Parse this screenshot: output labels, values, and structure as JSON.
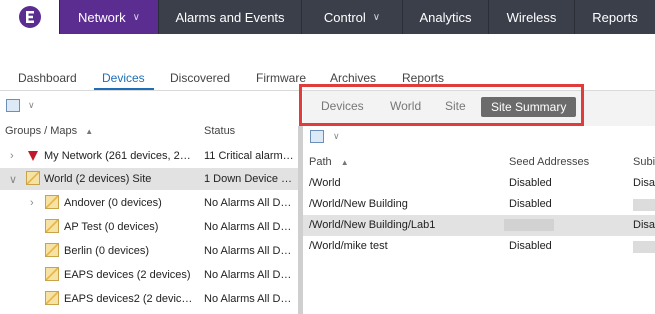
{
  "topnav": {
    "items": [
      {
        "label": "Network",
        "has_dropdown": true,
        "active": true
      },
      {
        "label": "Alarms and Events",
        "has_dropdown": false
      },
      {
        "label": "Control",
        "has_dropdown": true
      },
      {
        "label": "Analytics",
        "has_dropdown": false
      },
      {
        "label": "Wireless",
        "has_dropdown": false
      },
      {
        "label": "Reports",
        "has_dropdown": false
      }
    ],
    "dropdown_glyph": "∨"
  },
  "subtabs": [
    "Dashboard",
    "Devices",
    "Discovered",
    "Firmware",
    "Archives",
    "Reports"
  ],
  "active_subtab": "Devices",
  "left_panel": {
    "col_groups": "Groups / Maps",
    "sort_arrow": "▲",
    "col_status": "Status",
    "rows": [
      {
        "label": "My Network (261 devices, 2…",
        "status": "11 Critical alarm…",
        "icon": "red-triangle-icon",
        "expander": "›"
      },
      {
        "label": "World (2 devices) Site",
        "status": "1 Down Device …",
        "icon": "map-icon",
        "expander": "∨",
        "selected": true
      },
      {
        "label": "Andover (0 devices)",
        "status": "No Alarms All D…",
        "icon": "map-icon",
        "expander": "›"
      },
      {
        "label": "AP Test (0 devices)",
        "status": "No Alarms All D…",
        "icon": "map-icon",
        "expander": ""
      },
      {
        "label": "Berlin (0 devices)",
        "status": "No Alarms All D…",
        "icon": "map-icon",
        "expander": ""
      },
      {
        "label": "EAPS devices (2 devices)",
        "status": "No Alarms All D…",
        "icon": "map-icon",
        "expander": ""
      },
      {
        "label": "EAPS devices2 (2 devic…",
        "status": "No Alarms All D…",
        "icon": "map-icon",
        "expander": ""
      }
    ]
  },
  "view_tabs": [
    "Devices",
    "World",
    "Site",
    "Site Summary"
  ],
  "active_view_tab": "Site Summary",
  "grid": {
    "col_path": "Path",
    "sort_arrow": "▲",
    "col_seed": "Seed Addresses",
    "col_subnet": "Subi",
    "rows": [
      {
        "path": "/World",
        "seed": "Disabled",
        "subnet": "Disa"
      },
      {
        "path": "/World/New Building",
        "seed": "Disabled",
        "subnet": ""
      },
      {
        "path": "/World/New Building/Lab1",
        "seed": "",
        "subnet": "Disa",
        "selected": true
      },
      {
        "path": "/World/mike test",
        "seed": "Disabled",
        "subnet": ""
      }
    ]
  },
  "colors": {
    "nav_bg": "#3b3f4a",
    "nav_active": "#5c2d91",
    "accent": "#1e6fb8",
    "highlight_box": "#e03c3c",
    "alarm_red": "#c2182b"
  }
}
